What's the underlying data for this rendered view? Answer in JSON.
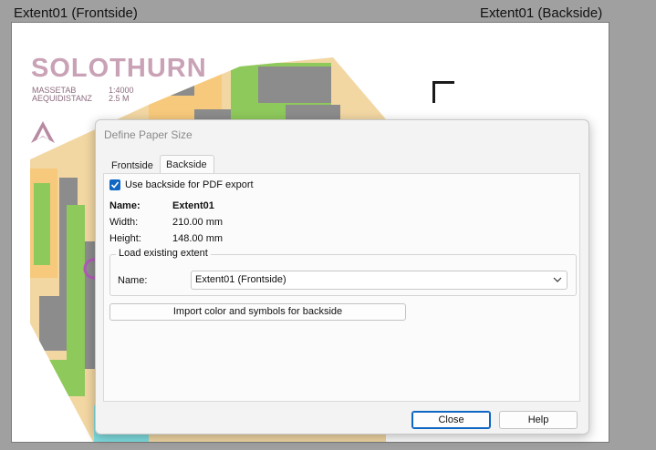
{
  "page_labels": {
    "frontside": "Extent01 (Frontside)",
    "backside": "Extent01 (Backside)"
  },
  "map": {
    "title": "SOLOTHURN",
    "scale_key": "MASSETAB",
    "scale_value": "1:4000",
    "equidistance_key": "AEQUIDISTANZ",
    "equidistance_value": "2.5 M",
    "north_icon": "north-arrow-icon",
    "colors": {
      "ground": "#f2d7a3",
      "paved": "#f7c97c",
      "building": "#8c8c8c",
      "green": "#8ec95b",
      "water": "#7fdde0",
      "course": "#b05ab8"
    }
  },
  "dialog": {
    "title": "Define Paper Size",
    "tabs": [
      "Frontside",
      "Backside"
    ],
    "active_tab": "Backside",
    "use_backside_checked": true,
    "use_backside_label": "Use backside for PDF export",
    "name_label": "Name:",
    "name_value": "Extent01",
    "width_label": "Width:",
    "width_value": "210.00 mm",
    "height_label": "Height:",
    "height_value": "148.00 mm",
    "load_group_title": "Load existing extent",
    "load_name_label": "Name:",
    "load_name_value": "Extent01 (Frontside)",
    "import_button": "Import color and symbols for backside",
    "close_button": "Close",
    "help_button": "Help",
    "accent_color": "#1066c3"
  }
}
